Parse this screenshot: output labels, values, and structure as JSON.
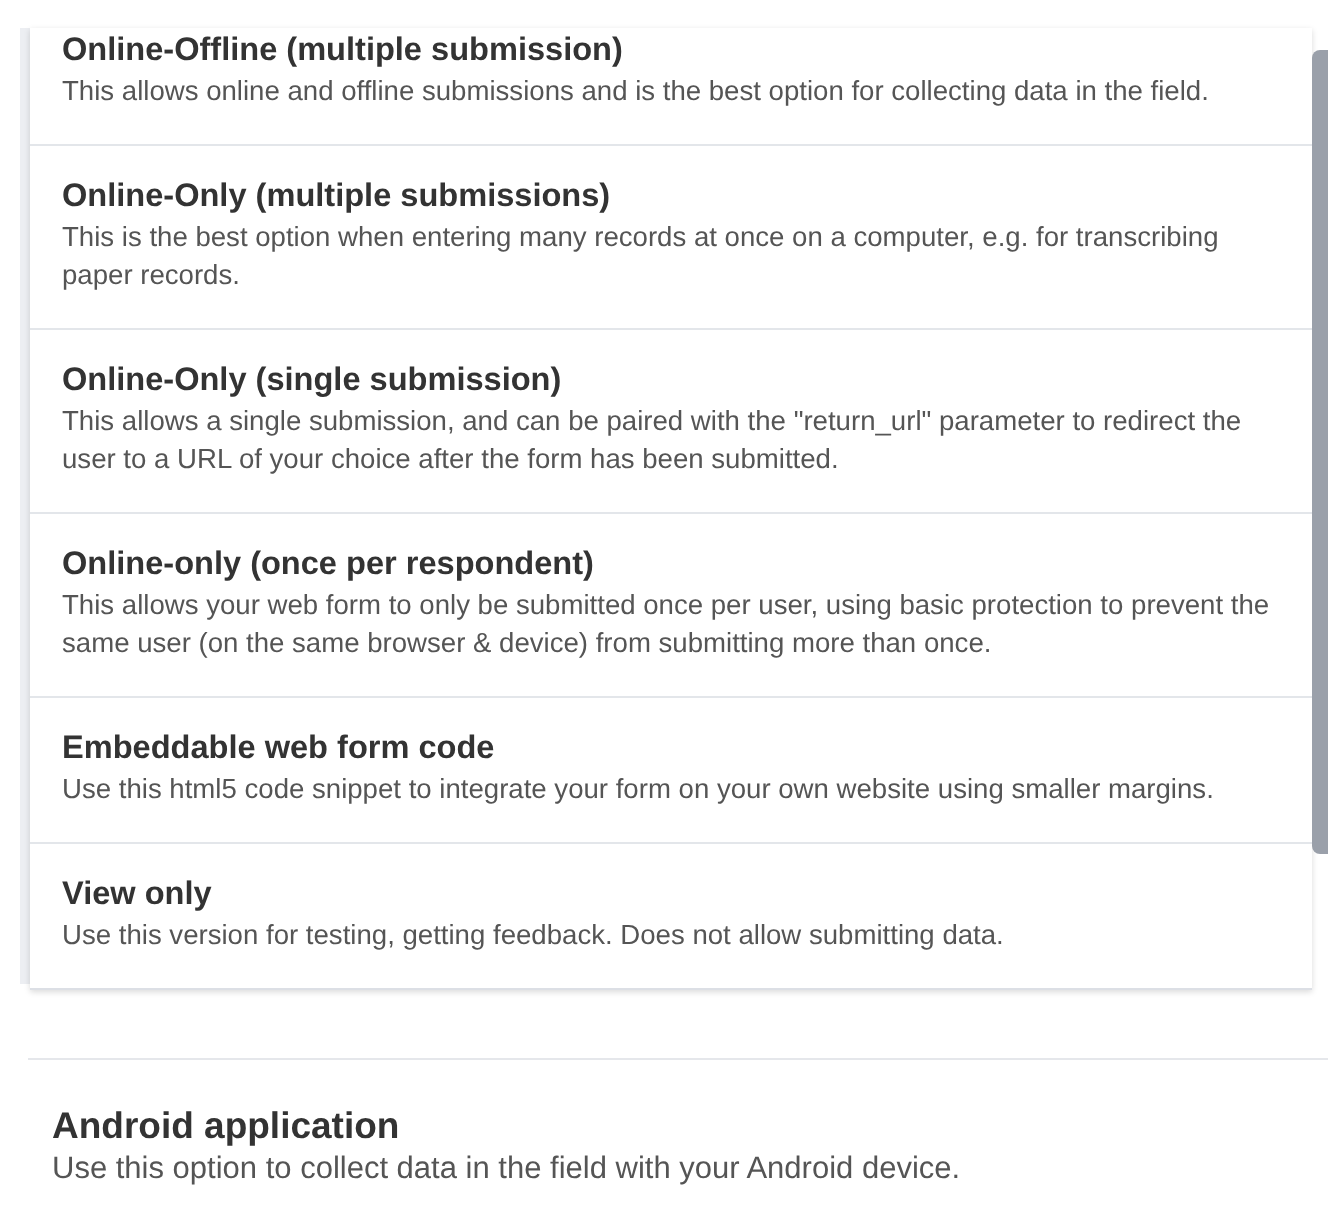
{
  "dropdown": {
    "items": [
      {
        "title": "Online-Offline (multiple submission)",
        "description": "This allows online and offline submissions and is the best option for collecting data in the field."
      },
      {
        "title": "Online-Only (multiple submissions)",
        "description": "This is the best option when entering many records at once on a computer, e.g. for transcribing paper records."
      },
      {
        "title": "Online-Only (single submission)",
        "description": "This allows a single submission, and can be paired with the \"return_url\" parameter to redirect the user to a URL of your choice after the form has been submitted."
      },
      {
        "title": "Online-only (once per respondent)",
        "description": "This allows your web form to only be submitted once per user, using basic protection to prevent the same user (on the same browser & device) from submitting more than once."
      },
      {
        "title": "Embeddable web form code",
        "description": "Use this html5 code snippet to integrate your form on your own website using smaller margins."
      },
      {
        "title": "View only",
        "description": "Use this version for testing, getting feedback. Does not allow submitting data."
      }
    ]
  },
  "android": {
    "title": "Android application",
    "description": "Use this option to collect data in the field with your Android device."
  }
}
